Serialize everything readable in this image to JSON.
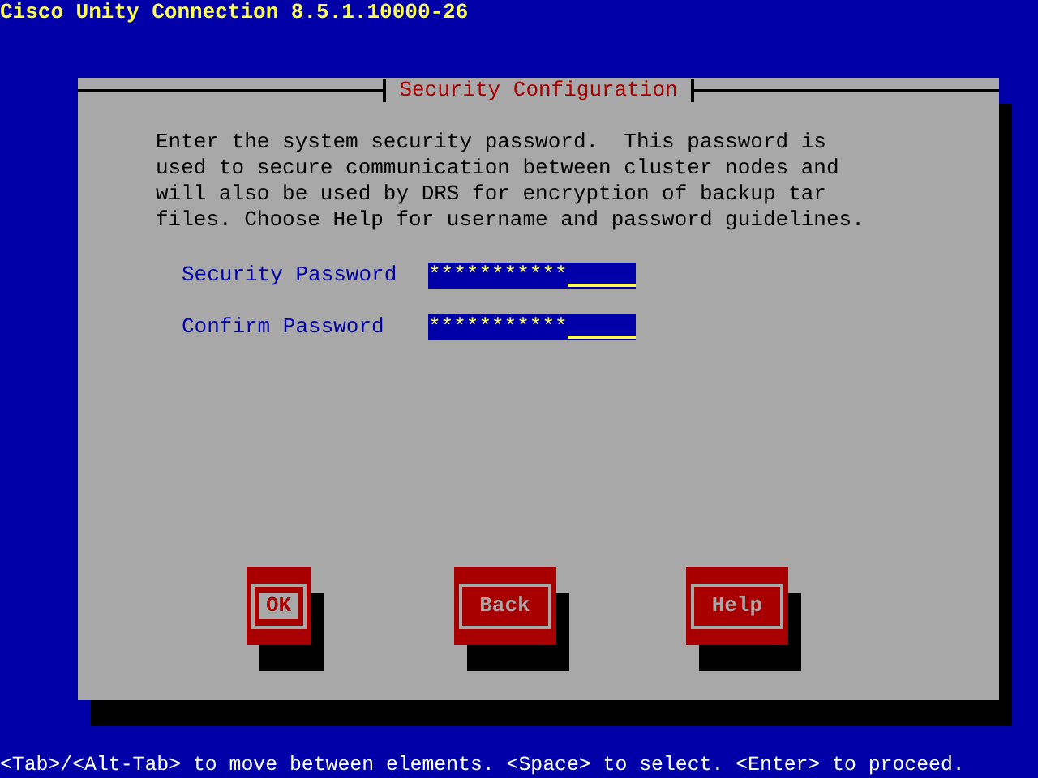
{
  "header": {
    "title": "Cisco Unity Connection 8.5.1.10000-26"
  },
  "dialog": {
    "title": "Security Configuration",
    "message": "Enter the system security password.  This password is used to secure communication between cluster nodes and will also be used by DRS for encryption of backup tar files. Choose Help for username and password guidelines.",
    "fields": [
      {
        "label": "Security Password",
        "value": "***********"
      },
      {
        "label": "Confirm Password",
        "value": "***********"
      }
    ],
    "buttons": [
      {
        "label": "OK",
        "selected": true
      },
      {
        "label": "Back",
        "selected": false
      },
      {
        "label": "Help",
        "selected": false
      }
    ]
  },
  "status_bar": "<Tab>/<Alt-Tab> to move between elements. <Space> to select. <Enter> to proceed."
}
